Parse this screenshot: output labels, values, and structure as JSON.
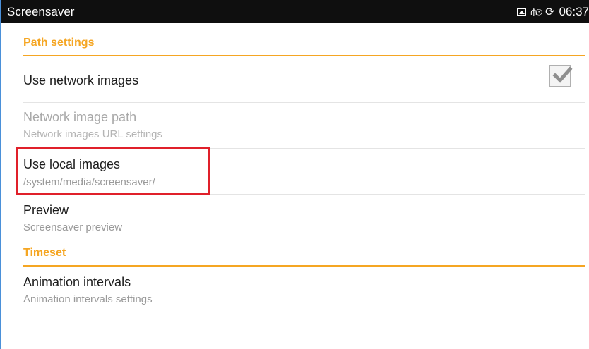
{
  "status_bar": {
    "title": "Screensaver",
    "time": "06:37",
    "icons": [
      "gallery-icon",
      "usb-icon",
      "sync-icon"
    ]
  },
  "sections": {
    "path": {
      "label": "Path settings"
    },
    "timeset": {
      "label": "Timeset"
    }
  },
  "prefs": {
    "use_network_images": {
      "title": "Use network images",
      "checked": true
    },
    "network_image_path": {
      "title": "Network image path",
      "summary": "Network images URL settings",
      "enabled": false
    },
    "use_local_images": {
      "title": "Use local images",
      "summary": "/system/media/screensaver/"
    },
    "preview": {
      "title": "Preview",
      "summary": "Screensaver preview"
    },
    "animation_intervals": {
      "title": "Animation intervals",
      "summary": "Animation intervals settings"
    }
  },
  "colors": {
    "accent": "#f5a623",
    "status_bar_bg": "#0f0f0f",
    "highlight": "#e0202a"
  }
}
